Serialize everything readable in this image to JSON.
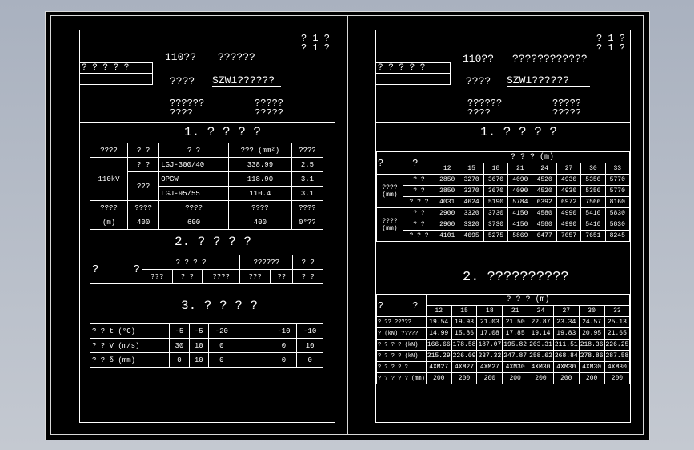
{
  "left": {
    "corner": [
      "? 1 ?",
      "? 1 ?"
    ],
    "stamp_box": "? ? ? ? ?",
    "title1": "110??",
    "title1b": "??????",
    "title2": "????",
    "model": "SZW1??????",
    "sub_left": [
      "??????",
      "????"
    ],
    "sub_right": [
      "?????",
      "?????"
    ],
    "section1": "1. ? ? ? ?",
    "t1_head": [
      "????",
      "? ?",
      "?  ?",
      "??? (mm²)",
      "????"
    ],
    "t1_group": "110kV",
    "t1_group2": "???",
    "t1_rows": [
      [
        "? ?",
        "LGJ-300/40",
        "338.99",
        "2.5"
      ],
      [
        "OPGW",
        "118.90",
        "3.1"
      ],
      [
        "LGJ-95/55",
        "110.4",
        "3.1"
      ]
    ],
    "t1_row4": [
      "????",
      "????",
      "????",
      "????",
      "????"
    ],
    "t1_row5": [
      "(m)",
      "400",
      "600",
      "400",
      "0°??"
    ],
    "section2": "2. ? ? ? ?",
    "t2_head": [
      "?",
      "?",
      "? ? ? ?",
      "??????",
      "? ?"
    ],
    "t2_sub": [
      "???",
      "? ?",
      "????",
      "???",
      "??",
      "? ?"
    ],
    "section3": "3. ? ? ? ?",
    "t3_rows": [
      [
        "? ?  t (°C)",
        "-5",
        "-5",
        "-20",
        "",
        "-10",
        "-10"
      ],
      [
        "? ?  V (m/s)",
        "30",
        "10",
        "0",
        "",
        "0",
        "10"
      ],
      [
        "? ?  δ (mm)",
        "0",
        "10",
        "0",
        "",
        "0",
        "0"
      ]
    ]
  },
  "right": {
    "corner": [
      "? 1 ?",
      "? 1 ?"
    ],
    "stamp_box": "? ? ? ? ?",
    "title1": "110??",
    "title1b": "????????????",
    "title2": "????",
    "model": "SZW1??????",
    "sub_left": [
      "??????",
      "????"
    ],
    "sub_right": [
      "?????",
      "?????"
    ],
    "section1": "1. ? ? ? ?",
    "t1_corner": [
      "?",
      "?"
    ],
    "t1_span_head": "? ? ? (m)",
    "t1_cols": [
      "12",
      "15",
      "18",
      "21",
      "24",
      "27",
      "30",
      "33"
    ],
    "t1_groups": [
      {
        "label": [
          "????",
          "(mm)"
        ],
        "rows": [
          {
            "k": "?  ?",
            "v": [
              "2850",
              "3270",
              "3670",
              "4090",
              "4520",
              "4930",
              "5350",
              "5770"
            ]
          },
          {
            "k": "?  ?",
            "v": [
              "2850",
              "3270",
              "3670",
              "4090",
              "4520",
              "4930",
              "5350",
              "5770"
            ]
          },
          {
            "k": "? ? ?",
            "v": [
              "4031",
              "4624",
              "5190",
              "5784",
              "6392",
              "6972",
              "7566",
              "8160"
            ]
          }
        ]
      },
      {
        "label": [
          "????",
          "(mm)"
        ],
        "rows": [
          {
            "k": "?  ?",
            "v": [
              "2900",
              "3320",
              "3730",
              "4150",
              "4580",
              "4990",
              "5410",
              "5830"
            ]
          },
          {
            "k": "?  ?",
            "v": [
              "2900",
              "3320",
              "3730",
              "4150",
              "4580",
              "4990",
              "5410",
              "5830"
            ]
          },
          {
            "k": "? ? ?",
            "v": [
              "4101",
              "4695",
              "5275",
              "5869",
              "6477",
              "7057",
              "7651",
              "8245"
            ]
          }
        ]
      }
    ],
    "section2": "2. ??????????",
    "t2_corner": [
      "?",
      "?"
    ],
    "t2_span_head": "? ? ? (m)",
    "t2_cols": [
      "12",
      "15",
      "18",
      "21",
      "24",
      "27",
      "30",
      "33"
    ],
    "t2_rows": [
      {
        "k": "?  ??  ?????",
        "v": [
          "19.54",
          "19.93",
          "21.03",
          "21.50",
          "22.87",
          "23.34",
          "24.57",
          "25.13"
        ]
      },
      {
        "k": "?  (kN) ?????",
        "v": [
          "14.99",
          "15.86",
          "17.08",
          "17.85",
          "19.14",
          "19.83",
          "20.95",
          "21.65"
        ]
      },
      {
        "k": "?  ? ? ?   (kN)",
        "v": [
          "166.66",
          "178.58",
          "187.07",
          "195.82",
          "203.31",
          "211.51",
          "218.36",
          "226.25"
        ]
      },
      {
        "k": "?  ? ? ?   (kN)",
        "v": [
          "215.29",
          "226.09",
          "237.32",
          "247.87",
          "258.62",
          "268.84",
          "278.86",
          "287.58"
        ]
      },
      {
        "k": "? ? ? ? ?",
        "v": [
          "4XM27",
          "4XM27",
          "4XM27",
          "4XM30",
          "4XM30",
          "4XM30",
          "4XM30",
          "4XM30"
        ]
      },
      {
        "k": "? ? ? ? ? (mm)",
        "v": [
          "200",
          "200",
          "200",
          "200",
          "200",
          "200",
          "200",
          "200"
        ]
      }
    ]
  }
}
